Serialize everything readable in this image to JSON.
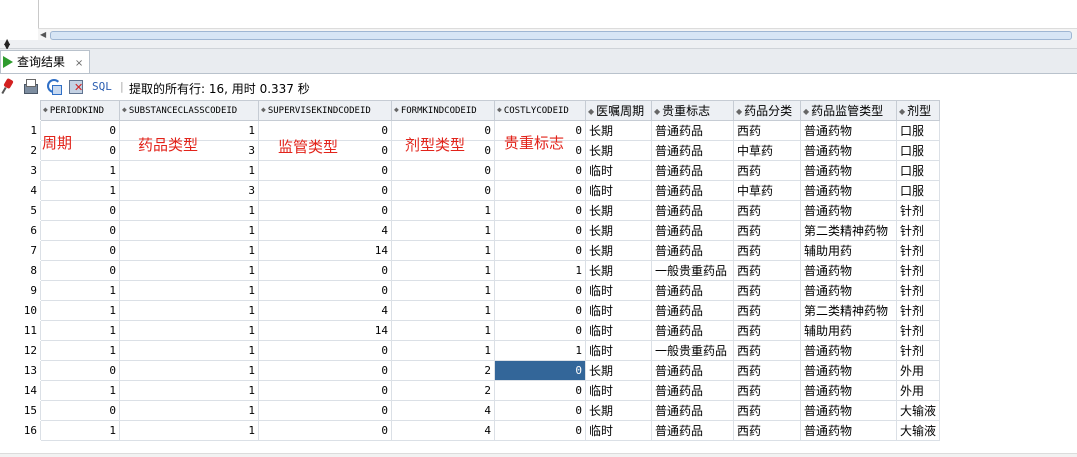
{
  "result_tab": {
    "label": "查询结果",
    "close": "×"
  },
  "toolbar": {
    "icons": [
      "pin-icon",
      "print-icon",
      "refresh-icon",
      "cancel-query-icon"
    ],
    "sql_label": "SQL",
    "separator": "|",
    "status": "提取的所有行: 16, 用时 0.337 秒"
  },
  "grid": {
    "columns": [
      "PERIODKIND",
      "SUBSTANCECLASSCODEID",
      "SUPERVISEKINDCODEID",
      "FORMKINDCODEID",
      "COSTLYCODEID",
      "医嘱周期",
      "贵重标志",
      "药品分类",
      "药品监管类型",
      "剂型"
    ],
    "rows": [
      [
        "1",
        "0",
        "1",
        "0",
        "0",
        "0",
        "长期",
        "普通药品",
        "西药",
        "普通药物",
        "口服"
      ],
      [
        "2",
        "0",
        "3",
        "0",
        "0",
        "0",
        "长期",
        "普通药品",
        "中草药",
        "普通药物",
        "口服"
      ],
      [
        "3",
        "1",
        "1",
        "0",
        "0",
        "0",
        "临时",
        "普通药品",
        "西药",
        "普通药物",
        "口服"
      ],
      [
        "4",
        "1",
        "3",
        "0",
        "0",
        "0",
        "临时",
        "普通药品",
        "中草药",
        "普通药物",
        "口服"
      ],
      [
        "5",
        "0",
        "1",
        "0",
        "1",
        "0",
        "长期",
        "普通药品",
        "西药",
        "普通药物",
        "针剂"
      ],
      [
        "6",
        "0",
        "1",
        "4",
        "1",
        "0",
        "长期",
        "普通药品",
        "西药",
        "第二类精神药物",
        "针剂"
      ],
      [
        "7",
        "0",
        "1",
        "14",
        "1",
        "0",
        "长期",
        "普通药品",
        "西药",
        "辅助用药",
        "针剂"
      ],
      [
        "8",
        "0",
        "1",
        "0",
        "1",
        "1",
        "长期",
        "一般贵重药品",
        "西药",
        "普通药物",
        "针剂"
      ],
      [
        "9",
        "1",
        "1",
        "0",
        "1",
        "0",
        "临时",
        "普通药品",
        "西药",
        "普通药物",
        "针剂"
      ],
      [
        "10",
        "1",
        "1",
        "4",
        "1",
        "0",
        "临时",
        "普通药品",
        "西药",
        "第二类精神药物",
        "针剂"
      ],
      [
        "11",
        "1",
        "1",
        "14",
        "1",
        "0",
        "临时",
        "普通药品",
        "西药",
        "辅助用药",
        "针剂"
      ],
      [
        "12",
        "1",
        "1",
        "0",
        "1",
        "1",
        "临时",
        "一般贵重药品",
        "西药",
        "普通药物",
        "针剂"
      ],
      [
        "13",
        "0",
        "1",
        "0",
        "2",
        "0",
        "长期",
        "普通药品",
        "西药",
        "普通药物",
        "外用"
      ],
      [
        "14",
        "1",
        "1",
        "0",
        "2",
        "0",
        "临时",
        "普通药品",
        "西药",
        "普通药物",
        "外用"
      ],
      [
        "15",
        "0",
        "1",
        "0",
        "4",
        "0",
        "长期",
        "普通药品",
        "西药",
        "普通药物",
        "大输液"
      ],
      [
        "16",
        "1",
        "1",
        "0",
        "4",
        "0",
        "临时",
        "普通药品",
        "西药",
        "普通药物",
        "大输液"
      ]
    ],
    "selected_cell": {
      "row": 13,
      "column": "COSTLYCODEID"
    }
  },
  "annotations": [
    "周期",
    "药品类型",
    "监管类型",
    "剂型类型",
    "贵重标志"
  ],
  "colors": {
    "annotation": "#e2231a",
    "selection": "#336699",
    "play": "#2e9b2e"
  }
}
